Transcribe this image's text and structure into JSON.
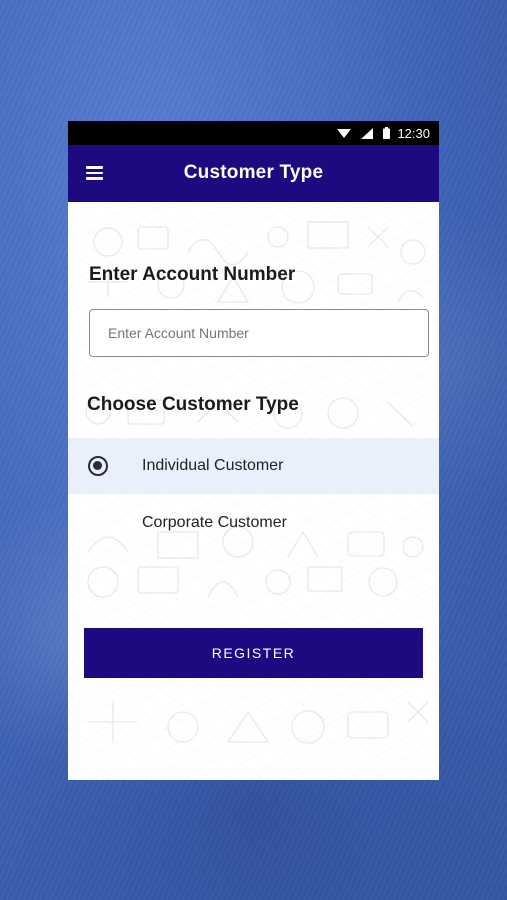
{
  "status_bar": {
    "time": "12:30",
    "icons": [
      "wifi-icon",
      "signal-icon",
      "battery-icon"
    ]
  },
  "app_bar": {
    "title": "Customer Type",
    "menu_icon": "hamburger-menu-icon"
  },
  "account": {
    "heading": "Enter Account Number",
    "placeholder": "Enter Account Number",
    "value": ""
  },
  "customer_type": {
    "heading": "Choose Customer Type",
    "options": [
      {
        "label": "Individual Customer",
        "selected": true
      },
      {
        "label": "Corporate Customer",
        "selected": false
      }
    ]
  },
  "register": {
    "label": "REGISTER"
  },
  "colors": {
    "primary": "#1d0a80",
    "selected_row": "#eaf0fb",
    "background": "#4a70c4"
  }
}
